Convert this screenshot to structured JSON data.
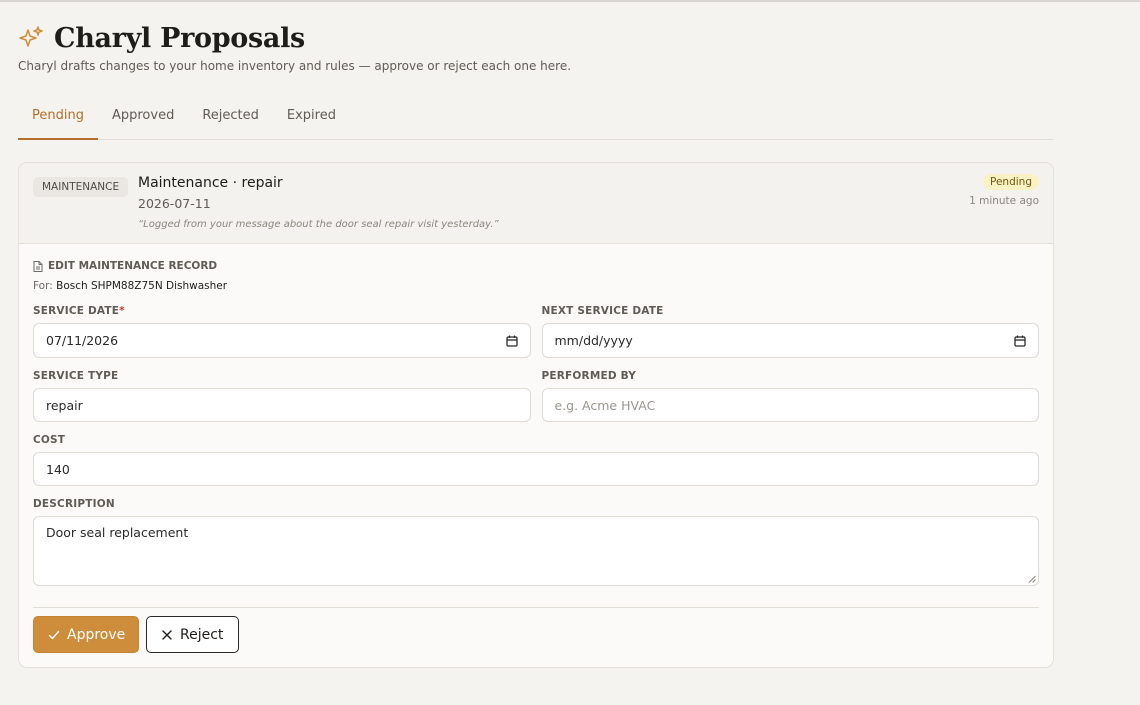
{
  "header": {
    "title": "Charyl Proposals",
    "subtitle": "Charyl drafts changes to your home inventory and rules — approve or reject each one here."
  },
  "tabs": [
    {
      "label": "Pending",
      "active": true
    },
    {
      "label": "Approved",
      "active": false
    },
    {
      "label": "Rejected",
      "active": false
    },
    {
      "label": "Expired",
      "active": false
    }
  ],
  "proposal": {
    "type_badge": "MAINTENANCE",
    "title": "Maintenance · repair",
    "date": "2026-07-11",
    "note": "“Logged from your message about the door seal repair visit yesterday.”",
    "status": "Pending",
    "time_ago": "1 minute ago",
    "section_label": "EDIT MAINTENANCE RECORD",
    "for_prefix": "For:",
    "for_target": "Bosch SHPM88Z75N Dishwasher",
    "fields": {
      "service_date": {
        "label": "SERVICE DATE",
        "required_mark": "*",
        "value": "07/11/2026"
      },
      "next_service_date": {
        "label": "NEXT SERVICE DATE",
        "placeholder": "mm/dd/yyyy"
      },
      "service_type": {
        "label": "SERVICE TYPE",
        "value": "repair"
      },
      "performed_by": {
        "label": "PERFORMED BY",
        "placeholder": "e.g. Acme HVAC"
      },
      "cost": {
        "label": "COST",
        "value": "140"
      },
      "description": {
        "label": "DESCRIPTION",
        "value": "Door seal replacement"
      }
    },
    "actions": {
      "approve_label": "Approve",
      "reject_label": "Reject"
    }
  },
  "colors": {
    "accent": "#b3702a",
    "approve_button": "#cd8d3a",
    "pending_badge_bg": "#fbf2c4",
    "background": "#f5f3ef"
  },
  "icons": {
    "title": "sparkle-icon",
    "section": "document-icon",
    "date_picker": "calendar-icon",
    "approve": "check-icon",
    "reject": "close-icon"
  }
}
